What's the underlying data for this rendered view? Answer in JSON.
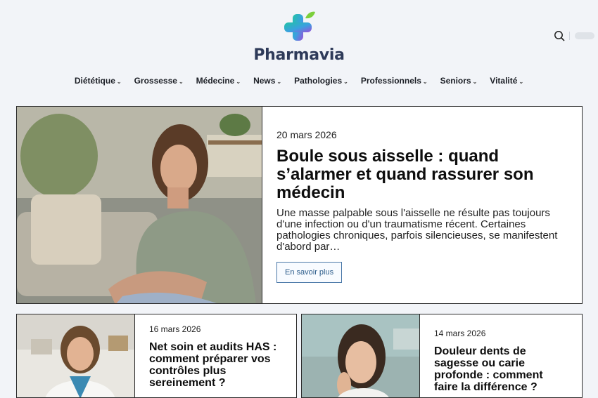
{
  "brand": {
    "name": "Pharmavia"
  },
  "header": {
    "search_icon": "search-icon"
  },
  "nav": {
    "items": [
      {
        "label": "Diététique"
      },
      {
        "label": "Grossesse"
      },
      {
        "label": "Médecine"
      },
      {
        "label": "News"
      },
      {
        "label": "Pathologies"
      },
      {
        "label": "Professionnels"
      },
      {
        "label": "Seniors"
      },
      {
        "label": "Vitalité"
      }
    ]
  },
  "featured": {
    "date": "20 mars 2026",
    "title": "Boule sous aisselle : quand s’alarmer et quand rassurer son médecin",
    "excerpt": "Une masse palpable sous l'aisselle ne résulte pas toujours d'une infection ou d'un traumatisme récent. Certaines pathologies chroniques, parfois silencieuses, se manifestent d'abord par…",
    "button": "En savoir plus"
  },
  "cards": [
    {
      "date": "16 mars 2026",
      "title": "Net soin et audits HAS : comment préparer vos contrôles plus sereinement ?"
    },
    {
      "date": "14 mars 2026",
      "title": "Douleur dents de sagesse ou carie profonde : comment faire la différence ?"
    }
  ],
  "colors": {
    "accent_button": "#4a78a8",
    "logo_green": "#2bc48a",
    "logo_purple": "#8a4fd8"
  }
}
